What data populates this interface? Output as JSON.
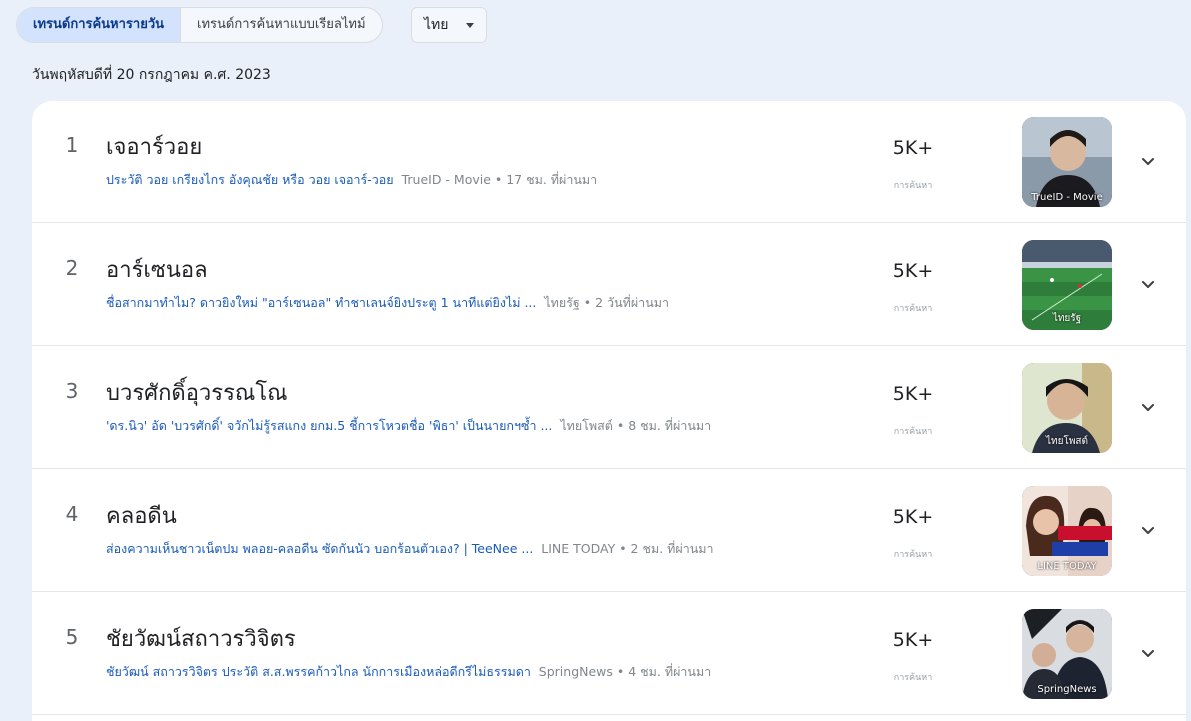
{
  "tabs": {
    "daily": "เทรนด์การค้นหารายวัน",
    "realtime": "เทรนด์การค้นหาแบบเรียลไทม์"
  },
  "language": {
    "selected": "ไทย"
  },
  "date": "วันพฤหัสบดีที่ 20 กรกฎาคม ค.ศ. 2023",
  "searches_label": "การค้นหา",
  "trends": [
    {
      "rank": "1",
      "title": "เจอาร์วอย",
      "article": "ประวัติ วอย เกรียงไกร อังคุณชัย หรือ วอย เจอาร์-วอย",
      "meta": "TrueID - Movie • 17 ชม. ที่ผ่านมา",
      "count": "5K+",
      "thumb_source": "TrueID - Movie"
    },
    {
      "rank": "2",
      "title": "อาร์เซนอล",
      "article": "ชื่อสากมาทำไม? ดาวยิงใหม่ \"อาร์เซนอล\" ทำชาเลนจ์ยิงประตู 1 นาทีแต่ยิงไม่ ...",
      "meta": "ไทยรัฐ • 2 วันที่ผ่านมา",
      "count": "5K+",
      "thumb_source": "ไทยรัฐ"
    },
    {
      "rank": "3",
      "title": "บวรศักดิ์อุวรรณโณ",
      "article": "'ดร.นิว' อัด 'บวรศักดิ์' จวักไม่รู้รสแกง ยกม.5 ชี้การโหวตชื่อ 'พิธา' เป็นนายกฯซ้ำ ...",
      "meta": "ไทยโพสต์ • 8 ชม. ที่ผ่านมา",
      "count": "5K+",
      "thumb_source": "ไทยโพสต์"
    },
    {
      "rank": "4",
      "title": "คลอดีน",
      "article": "ส่องความเห็นชาวเน็ตปม พลอย-คลอดีน ซัดกันนัว บอกร้อนตัวเอง? | TeeNee ...",
      "meta": "LINE TODAY • 2 ชม. ที่ผ่านมา",
      "count": "5K+",
      "thumb_source": "LINE TODAY"
    },
    {
      "rank": "5",
      "title": "ชัยวัฒน์สถาวรวิจิตร",
      "article": "ชัยวัฒน์ สถาวรวิจิตร ประวัติ ส.ส.พรรคก้าวไกล นักการเมืองหล่อดีกรีไม่ธรรมดา",
      "meta": "SpringNews • 4 ชม. ที่ผ่านมา",
      "count": "5K+",
      "thumb_source": "SpringNews"
    }
  ]
}
